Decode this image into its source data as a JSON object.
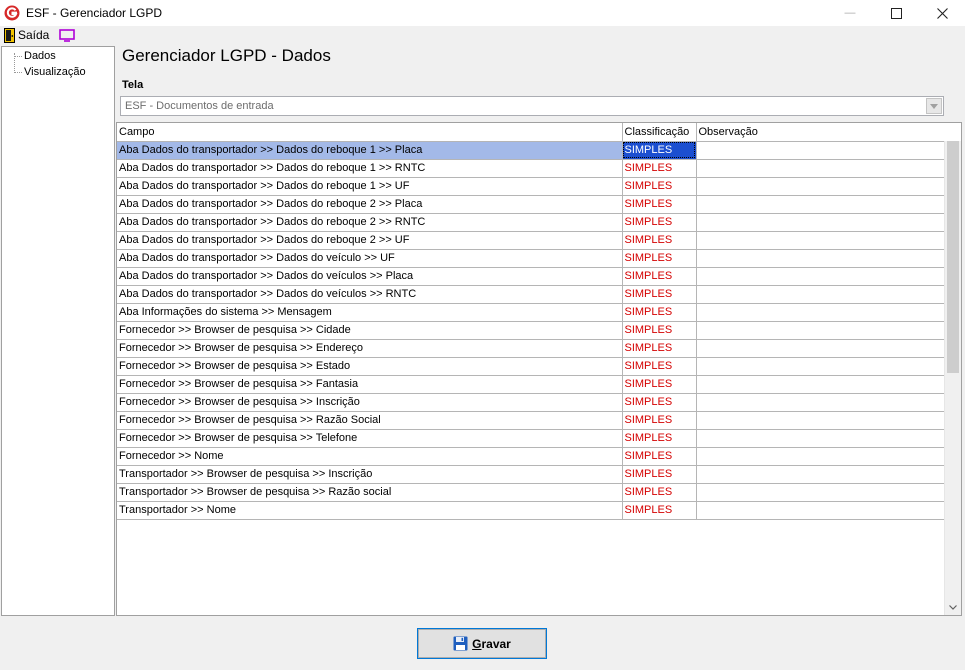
{
  "window": {
    "title": "ESF - Gerenciador LGPD",
    "controls": {
      "minimize": "—",
      "maximize": "☐",
      "close": "✕"
    }
  },
  "toolbar": {
    "exit_label": "Saída",
    "exit_icon": "door-exit-icon",
    "screen_icon": "monitor-icon"
  },
  "sidebar": {
    "items": [
      {
        "label": "Dados"
      },
      {
        "label": "Visualização"
      }
    ]
  },
  "main": {
    "title": "Gerenciador LGPD - Dados",
    "tela_label": "Tela",
    "tela_value": "ESF - Documentos de entrada"
  },
  "grid": {
    "columns": [
      "Campo",
      "Classificação",
      "Observação"
    ],
    "rows": [
      {
        "campo": "Aba Dados do transportador >> Dados do reboque 1 >> Placa",
        "classificacao": "SIMPLES",
        "observacao": "",
        "selected": true
      },
      {
        "campo": "Aba Dados do transportador >> Dados do reboque 1 >> RNTC",
        "classificacao": "SIMPLES",
        "observacao": ""
      },
      {
        "campo": "Aba Dados do transportador >> Dados do reboque 1 >> UF",
        "classificacao": "SIMPLES",
        "observacao": ""
      },
      {
        "campo": "Aba Dados do transportador >> Dados do reboque 2 >> Placa",
        "classificacao": "SIMPLES",
        "observacao": ""
      },
      {
        "campo": "Aba Dados do transportador >> Dados do reboque 2 >> RNTC",
        "classificacao": "SIMPLES",
        "observacao": ""
      },
      {
        "campo": "Aba Dados do transportador >> Dados do reboque 2 >> UF",
        "classificacao": "SIMPLES",
        "observacao": ""
      },
      {
        "campo": "Aba Dados do transportador >> Dados do veículo >> UF",
        "classificacao": "SIMPLES",
        "observacao": ""
      },
      {
        "campo": "Aba Dados do transportador >> Dados do veículos >> Placa",
        "classificacao": "SIMPLES",
        "observacao": ""
      },
      {
        "campo": "Aba Dados do transportador >> Dados do veículos >> RNTC",
        "classificacao": "SIMPLES",
        "observacao": ""
      },
      {
        "campo": "Aba Informações do sistema >> Mensagem",
        "classificacao": "SIMPLES",
        "observacao": ""
      },
      {
        "campo": "Fornecedor >> Browser de pesquisa >> Cidade",
        "classificacao": "SIMPLES",
        "observacao": ""
      },
      {
        "campo": "Fornecedor >> Browser de pesquisa >> Endereço",
        "classificacao": "SIMPLES",
        "observacao": ""
      },
      {
        "campo": "Fornecedor >> Browser de pesquisa >> Estado",
        "classificacao": "SIMPLES",
        "observacao": ""
      },
      {
        "campo": "Fornecedor >> Browser de pesquisa >> Fantasia",
        "classificacao": "SIMPLES",
        "observacao": ""
      },
      {
        "campo": "Fornecedor >> Browser de pesquisa >> Inscrição",
        "classificacao": "SIMPLES",
        "observacao": ""
      },
      {
        "campo": "Fornecedor >> Browser de pesquisa >> Razão Social",
        "classificacao": "SIMPLES",
        "observacao": ""
      },
      {
        "campo": "Fornecedor >> Browser de pesquisa >> Telefone",
        "classificacao": "SIMPLES",
        "observacao": ""
      },
      {
        "campo": "Fornecedor >> Nome",
        "classificacao": "SIMPLES",
        "observacao": ""
      },
      {
        "campo": "Transportador >> Browser de pesquisa >> Inscrição",
        "classificacao": "SIMPLES",
        "observacao": ""
      },
      {
        "campo": "Transportador >> Browser de pesquisa >> Razão social",
        "classificacao": "SIMPLES",
        "observacao": ""
      },
      {
        "campo": "Transportador >> Nome",
        "classificacao": "SIMPLES",
        "observacao": ""
      }
    ]
  },
  "footer": {
    "save_label_underlined": "G",
    "save_label_rest": "ravar",
    "save_icon": "floppy-disk-icon"
  },
  "colors": {
    "accent": "#0078d7",
    "classification_text": "#d40000",
    "selected_row": "#a3b9e8",
    "selected_cell": "#1c4fd0"
  }
}
